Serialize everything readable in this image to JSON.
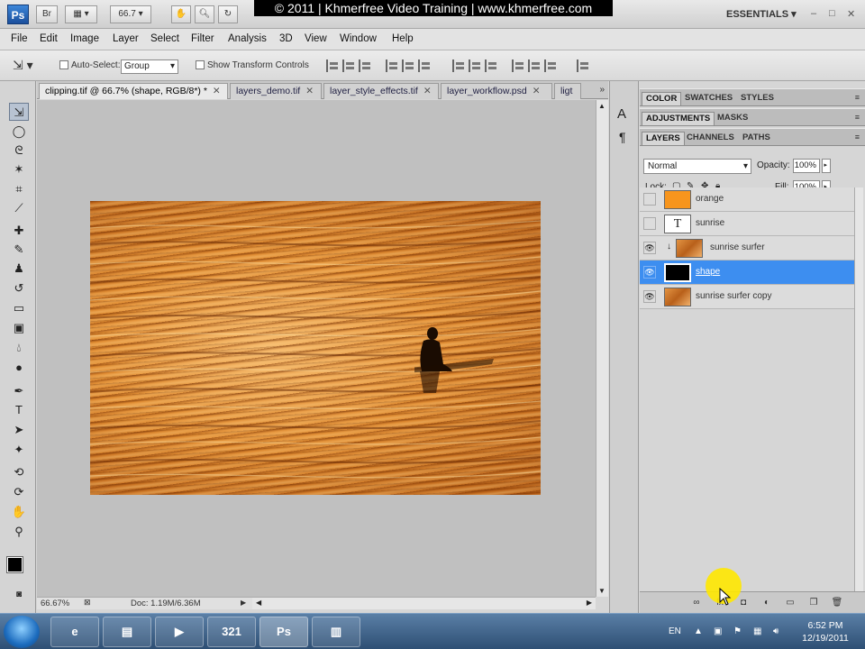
{
  "watermark": "© 2011 | Khmerfree Video Training | www.khmerfree.com",
  "appbar": {
    "logo": "Ps",
    "br_label": "Br",
    "zoom_value": "66.7",
    "workspace": "ESSENTIALS",
    "window_controls": [
      "–",
      "□",
      "✕"
    ]
  },
  "menu": [
    "File",
    "Edit",
    "Image",
    "Layer",
    "Select",
    "Filter",
    "Analysis",
    "3D",
    "View",
    "Window",
    "Help"
  ],
  "options": {
    "auto_select_label": "Auto-Select:",
    "auto_select_value": "Group",
    "show_transform_label": "Show Transform Controls"
  },
  "tabs": [
    {
      "label": "clipping.tif @ 66.7% (shape, RGB/8*) *",
      "close": "✕"
    },
    {
      "label": "layers_demo.tif",
      "close": "✕"
    },
    {
      "label": "layer_style_effects.tif",
      "close": "✕"
    },
    {
      "label": "layer_workflow.psd",
      "close": "✕"
    },
    {
      "label": "ligt",
      "close": ""
    }
  ],
  "tabs_more": "»",
  "status": {
    "zoom": "66.67%",
    "doc": "Doc: 1.19M/6.36M"
  },
  "panels": {
    "group1": [
      "COLOR",
      "SWATCHES",
      "STYLES"
    ],
    "group2": [
      "ADJUSTMENTS",
      "MASKS"
    ],
    "group3": [
      "LAYERS",
      "CHANNELS",
      "PATHS"
    ],
    "blend_mode": "Normal",
    "opacity_label": "Opacity:",
    "opacity_value": "100%",
    "lock_label": "Lock:",
    "fill_label": "Fill:",
    "fill_value": "100%"
  },
  "layers": [
    {
      "name": "orange",
      "visible": false,
      "thumb": "#f7951d"
    },
    {
      "name": "sunrise",
      "visible": false,
      "thumb": "text",
      "thumb_text": "T"
    },
    {
      "name": "sunrise surfer",
      "visible": true,
      "thumb": "photo",
      "clipped": true
    },
    {
      "name": "shape",
      "visible": true,
      "thumb": "shape",
      "selected": true
    },
    {
      "name": "sunrise surfer copy",
      "visible": true,
      "thumb": "photo"
    }
  ],
  "taskbar": {
    "language": "EN",
    "time": "6:52 PM",
    "date": "12/19/2011",
    "ps_button": "Ps"
  },
  "colors": {
    "selection": "#3d8ef0",
    "orange_fill": "#f7951d",
    "cursor_highlight": "#ffe800"
  }
}
